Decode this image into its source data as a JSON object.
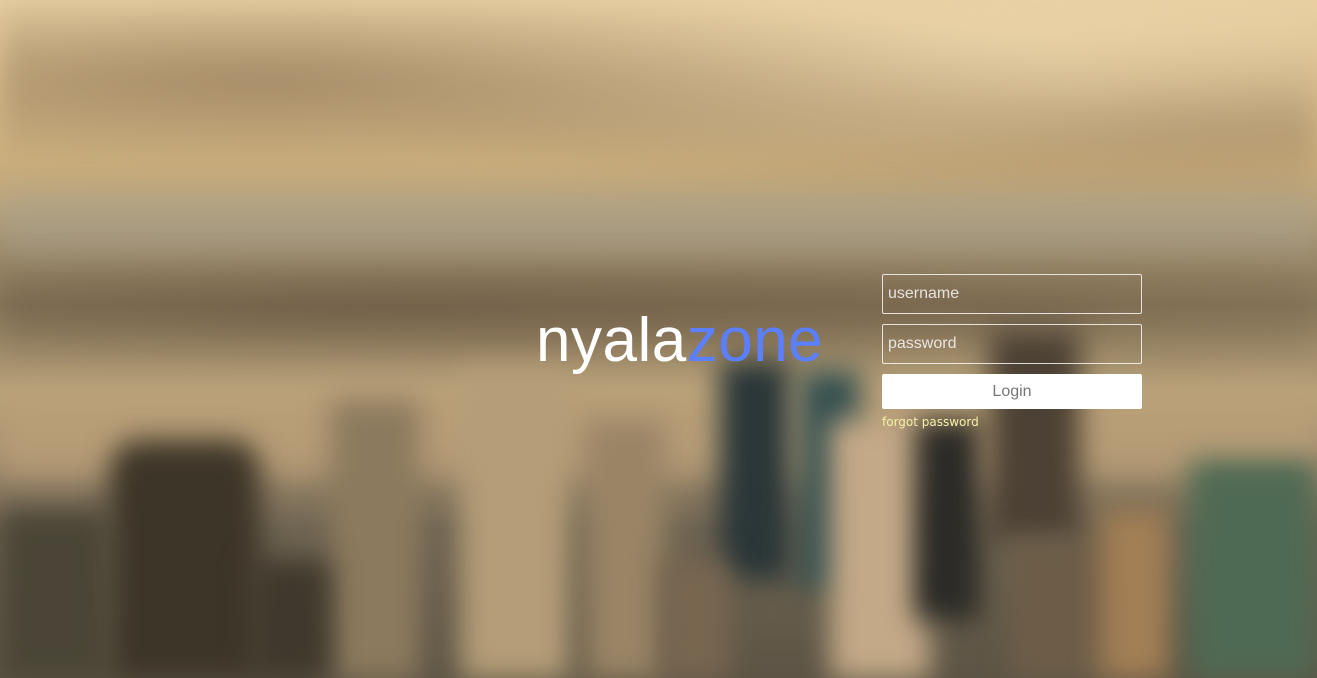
{
  "logo": {
    "part1": "nyala",
    "part2": "zone",
    "accent_color": "#5b7fff"
  },
  "login_form": {
    "username_placeholder": "username",
    "password_placeholder": "password",
    "login_label": "Login",
    "forgot_label": "forgot password"
  }
}
